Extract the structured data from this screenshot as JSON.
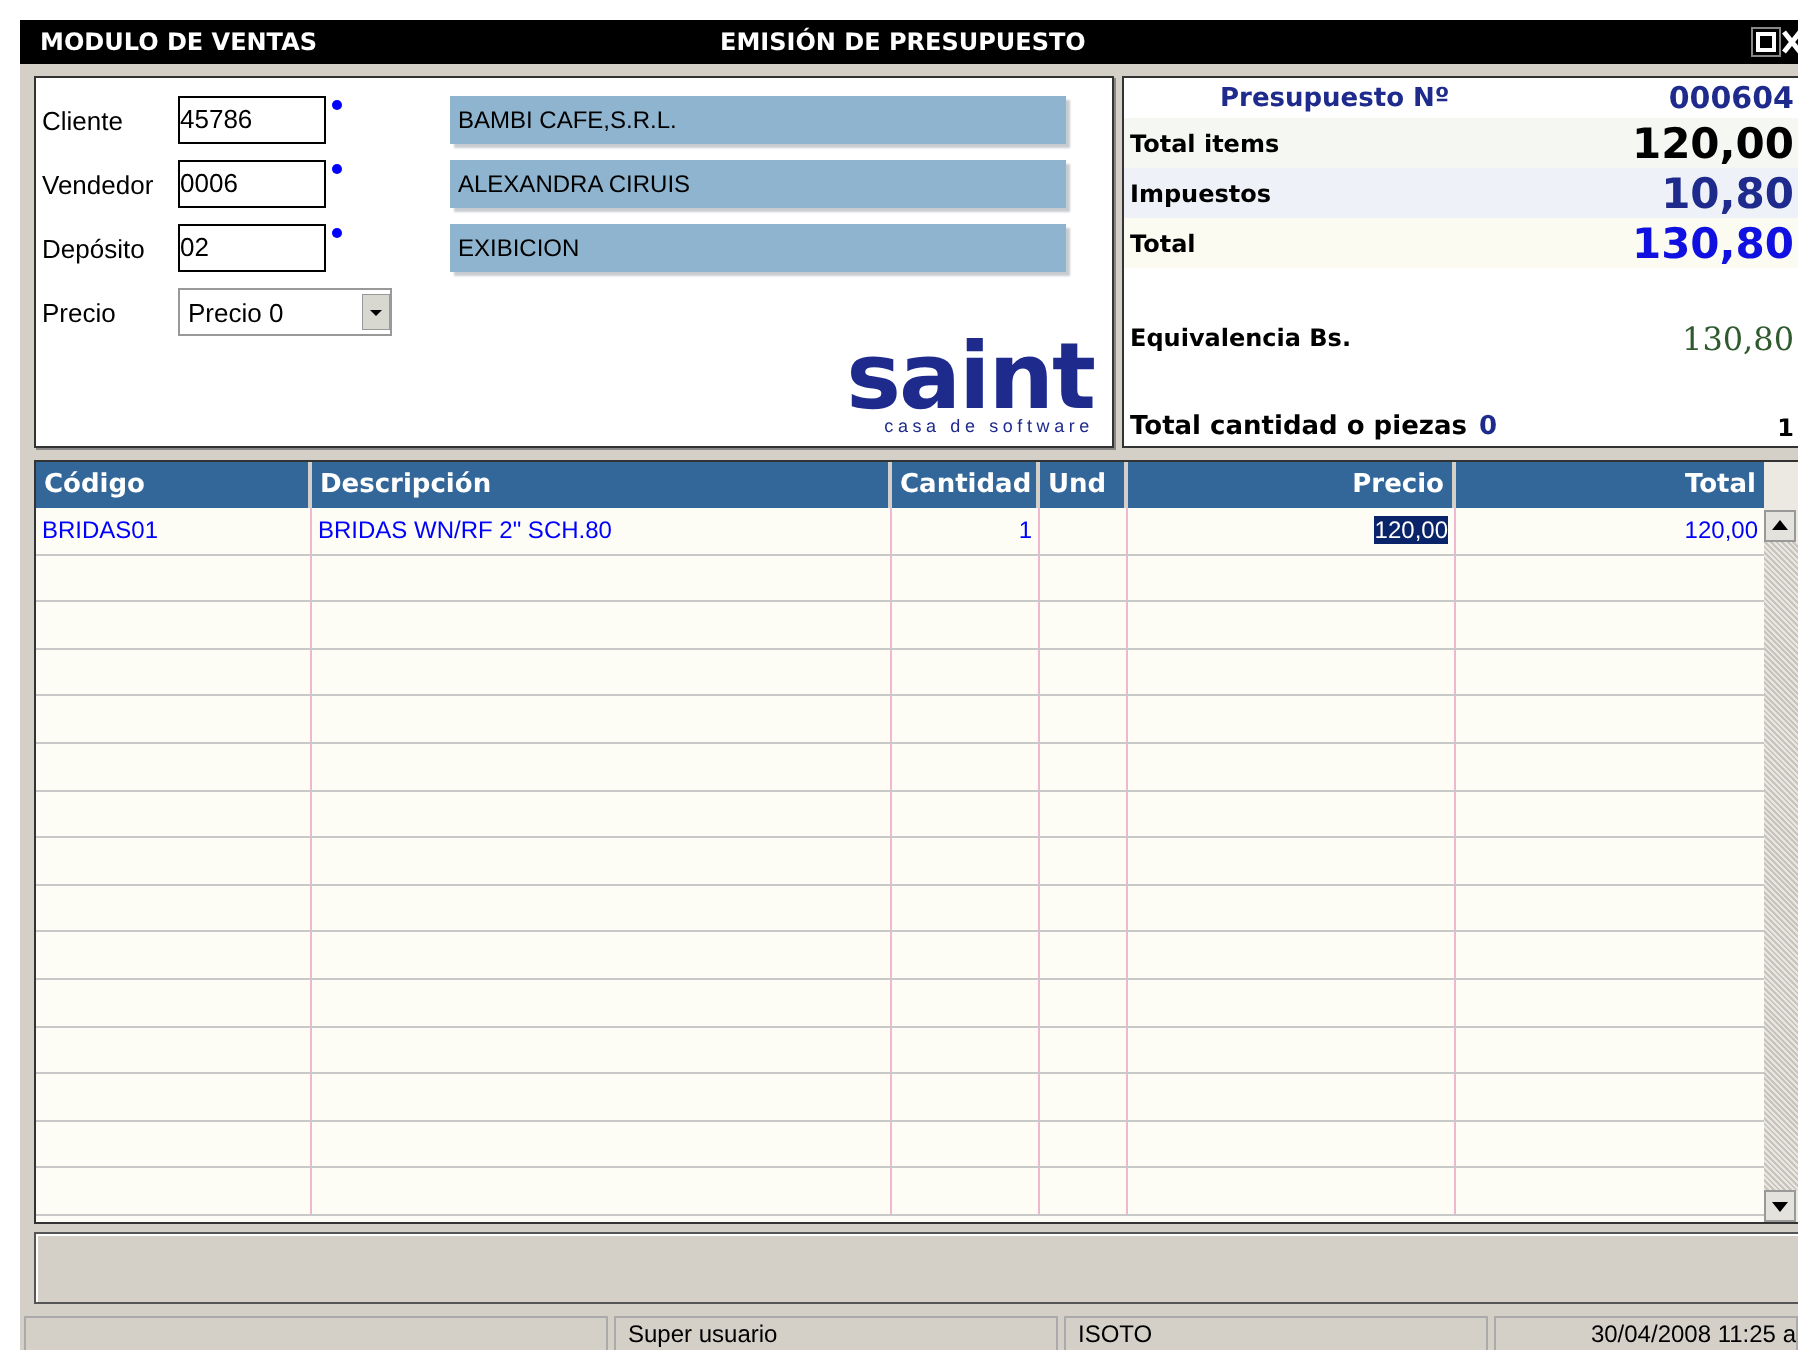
{
  "window": {
    "title": "MODULO DE VENTAS",
    "subtitle": "EMISIÓN DE PRESUPUESTO"
  },
  "fields": [
    {
      "label": "Cliente",
      "value": "45786",
      "required": true,
      "description": "BAMBI CAFE,S.R.L."
    },
    {
      "label": "Vendedor",
      "value": "0006",
      "required": true,
      "description": "ALEXANDRA CIRUIS"
    },
    {
      "label": "Depósito",
      "value": "02",
      "required": true,
      "description": "EXIBICION"
    }
  ],
  "price_select": {
    "label": "Precio",
    "value": "Precio 0"
  },
  "logo": {
    "name": "saint",
    "tagline": "casa de software"
  },
  "summary": {
    "number_label": "Presupuesto Nº",
    "number": "000604",
    "rows": [
      {
        "kind": "total",
        "label": "Total items",
        "value": "120,00"
      },
      {
        "kind": "tax",
        "label": "Impuestos",
        "value": "10,80"
      },
      {
        "kind": "grand",
        "label": "Total",
        "value": "130,80"
      },
      {
        "kind": "equiv",
        "label": "Equivalencia Bs.",
        "value": "130,80"
      }
    ],
    "pieces_label": "Total cantidad o piezas",
    "pieces_value": "0",
    "pieces_count": "1"
  },
  "table": {
    "columns": [
      "Código",
      "Descripción",
      "Cantidad",
      "Und",
      "Precio",
      "Total"
    ],
    "rows": [
      {
        "cells": [
          {
            "text": "BRIDAS01",
            "selected": false
          },
          {
            "text": "BRIDAS WN/RF 2\" SCH.80",
            "selected": false
          },
          {
            "text": "1",
            "selected": false
          },
          {
            "selected": false
          },
          {
            "text": "120,00",
            "selected": true
          },
          {
            "text": "120,00",
            "selected": false
          }
        ]
      }
    ]
  },
  "status_bar": [
    "Super usuario",
    "ISOTO",
    "30/04/2008 11:25 a"
  ]
}
